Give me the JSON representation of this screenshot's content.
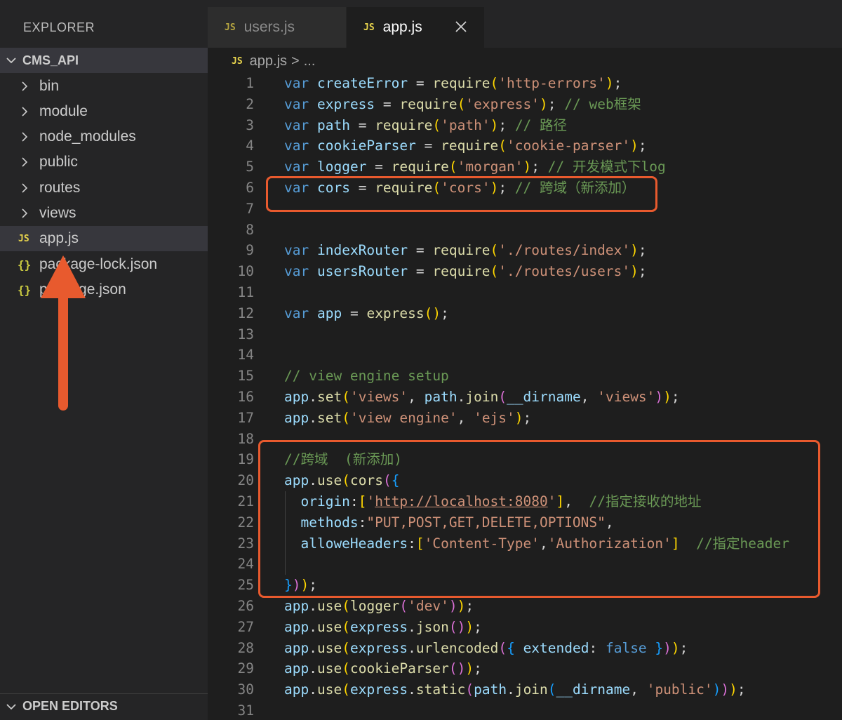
{
  "sidebar": {
    "title": "EXPLORER",
    "project": "CMS_API",
    "items": [
      {
        "label": "bin",
        "kind": "folder"
      },
      {
        "label": "module",
        "kind": "folder"
      },
      {
        "label": "node_modules",
        "kind": "folder"
      },
      {
        "label": "public",
        "kind": "folder"
      },
      {
        "label": "routes",
        "kind": "folder"
      },
      {
        "label": "views",
        "kind": "folder"
      },
      {
        "label": "app.js",
        "kind": "js",
        "badge": "JS",
        "selected": true
      },
      {
        "label": "package-lock.json",
        "kind": "json",
        "badge": "{}"
      },
      {
        "label": "package.json",
        "kind": "json",
        "badge": "{}"
      }
    ],
    "open_editors": "OPEN EDITORS"
  },
  "tabs": [
    {
      "label": "users.js",
      "badge": "JS",
      "active": false
    },
    {
      "label": "app.js",
      "badge": "JS",
      "active": true
    }
  ],
  "breadcrumb": {
    "badge": "JS",
    "file": "app.js",
    "separator": ">",
    "rest": "..."
  },
  "editor": {
    "lines": [
      {
        "n": "1",
        "tokens": [
          [
            "kw",
            "var"
          ],
          [
            "pu",
            " "
          ],
          [
            "vr",
            "createError"
          ],
          [
            "pu",
            " = "
          ],
          [
            "fn",
            "require"
          ],
          [
            "b1",
            "("
          ],
          [
            "st",
            "'http-errors'"
          ],
          [
            "b1",
            ")"
          ],
          [
            "pu",
            ";"
          ]
        ]
      },
      {
        "n": "2",
        "tokens": [
          [
            "kw",
            "var"
          ],
          [
            "pu",
            " "
          ],
          [
            "vr",
            "express"
          ],
          [
            "pu",
            " = "
          ],
          [
            "fn",
            "require"
          ],
          [
            "b1",
            "("
          ],
          [
            "st",
            "'express'"
          ],
          [
            "b1",
            ")"
          ],
          [
            "pu",
            "; "
          ],
          [
            "cm",
            "// web框架"
          ]
        ]
      },
      {
        "n": "3",
        "tokens": [
          [
            "kw",
            "var"
          ],
          [
            "pu",
            " "
          ],
          [
            "vr",
            "path"
          ],
          [
            "pu",
            " = "
          ],
          [
            "fn",
            "require"
          ],
          [
            "b1",
            "("
          ],
          [
            "st",
            "'path'"
          ],
          [
            "b1",
            ")"
          ],
          [
            "pu",
            "; "
          ],
          [
            "cm",
            "// 路径"
          ]
        ]
      },
      {
        "n": "4",
        "tokens": [
          [
            "kw",
            "var"
          ],
          [
            "pu",
            " "
          ],
          [
            "vr",
            "cookieParser"
          ],
          [
            "pu",
            " = "
          ],
          [
            "fn",
            "require"
          ],
          [
            "b1",
            "("
          ],
          [
            "st",
            "'cookie-parser'"
          ],
          [
            "b1",
            ")"
          ],
          [
            "pu",
            ";"
          ]
        ]
      },
      {
        "n": "5",
        "tokens": [
          [
            "kw",
            "var"
          ],
          [
            "pu",
            " "
          ],
          [
            "vr",
            "logger"
          ],
          [
            "pu",
            " = "
          ],
          [
            "fn",
            "require"
          ],
          [
            "b1",
            "("
          ],
          [
            "st",
            "'morgan'"
          ],
          [
            "b1",
            ")"
          ],
          [
            "pu",
            "; "
          ],
          [
            "cm",
            "// 开发模式下log"
          ]
        ]
      },
      {
        "n": "6",
        "tokens": [
          [
            "kw",
            "var"
          ],
          [
            "pu",
            " "
          ],
          [
            "vr",
            "cors"
          ],
          [
            "pu",
            " = "
          ],
          [
            "fn",
            "require"
          ],
          [
            "b1",
            "("
          ],
          [
            "st",
            "'cors'"
          ],
          [
            "b1",
            ")"
          ],
          [
            "pu",
            "; "
          ],
          [
            "cm",
            "// 跨域（新添加）"
          ]
        ]
      },
      {
        "n": "7",
        "tokens": []
      },
      {
        "n": "8",
        "tokens": []
      },
      {
        "n": "9",
        "tokens": [
          [
            "kw",
            "var"
          ],
          [
            "pu",
            " "
          ],
          [
            "vr",
            "indexRouter"
          ],
          [
            "pu",
            " = "
          ],
          [
            "fn",
            "require"
          ],
          [
            "b1",
            "("
          ],
          [
            "st",
            "'./routes/index'"
          ],
          [
            "b1",
            ")"
          ],
          [
            "pu",
            ";"
          ]
        ]
      },
      {
        "n": "10",
        "tokens": [
          [
            "kw",
            "var"
          ],
          [
            "pu",
            " "
          ],
          [
            "vr",
            "usersRouter"
          ],
          [
            "pu",
            " = "
          ],
          [
            "fn",
            "require"
          ],
          [
            "b1",
            "("
          ],
          [
            "st",
            "'./routes/users'"
          ],
          [
            "b1",
            ")"
          ],
          [
            "pu",
            ";"
          ]
        ]
      },
      {
        "n": "11",
        "tokens": []
      },
      {
        "n": "12",
        "tokens": [
          [
            "kw",
            "var"
          ],
          [
            "pu",
            " "
          ],
          [
            "vr",
            "app"
          ],
          [
            "pu",
            " = "
          ],
          [
            "fn",
            "express"
          ],
          [
            "b1",
            "()"
          ],
          [
            "pu",
            ";"
          ]
        ]
      },
      {
        "n": "13",
        "tokens": []
      },
      {
        "n": "14",
        "tokens": []
      },
      {
        "n": "15",
        "tokens": [
          [
            "cm",
            "// view engine setup"
          ]
        ]
      },
      {
        "n": "16",
        "tokens": [
          [
            "vr",
            "app"
          ],
          [
            "pu",
            "."
          ],
          [
            "fn",
            "set"
          ],
          [
            "b1",
            "("
          ],
          [
            "st",
            "'views'"
          ],
          [
            "pu",
            ", "
          ],
          [
            "vr",
            "path"
          ],
          [
            "pu",
            "."
          ],
          [
            "fn",
            "join"
          ],
          [
            "b2",
            "("
          ],
          [
            "vr",
            "__dirname"
          ],
          [
            "pu",
            ", "
          ],
          [
            "st",
            "'views'"
          ],
          [
            "b2",
            ")"
          ],
          [
            "b1",
            ")"
          ],
          [
            "pu",
            ";"
          ]
        ]
      },
      {
        "n": "17",
        "tokens": [
          [
            "vr",
            "app"
          ],
          [
            "pu",
            "."
          ],
          [
            "fn",
            "set"
          ],
          [
            "b1",
            "("
          ],
          [
            "st",
            "'view engine'"
          ],
          [
            "pu",
            ", "
          ],
          [
            "st",
            "'ejs'"
          ],
          [
            "b1",
            ")"
          ],
          [
            "pu",
            ";"
          ]
        ]
      },
      {
        "n": "18",
        "tokens": []
      },
      {
        "n": "19",
        "tokens": [
          [
            "cm",
            "//跨域  (新添加)"
          ]
        ]
      },
      {
        "n": "20",
        "tokens": [
          [
            "vr",
            "app"
          ],
          [
            "pu",
            "."
          ],
          [
            "fn",
            "use"
          ],
          [
            "b1",
            "("
          ],
          [
            "fn",
            "cors"
          ],
          [
            "b2",
            "("
          ],
          [
            "b3",
            "{"
          ]
        ]
      },
      {
        "n": "21",
        "guide": true,
        "tokens": [
          [
            "pu",
            "  "
          ],
          [
            "vr",
            "origin"
          ],
          [
            "pu",
            ":"
          ],
          [
            "b1",
            "["
          ],
          [
            "st",
            "'"
          ],
          [
            "st ul",
            "http://localhost:8080"
          ],
          [
            "st",
            "'"
          ],
          [
            "b1",
            "]"
          ],
          [
            "pu",
            ",  "
          ],
          [
            "cm",
            "//指定接收的地址"
          ]
        ]
      },
      {
        "n": "22",
        "guide": true,
        "tokens": [
          [
            "pu",
            "  "
          ],
          [
            "vr",
            "methods"
          ],
          [
            "pu",
            ":"
          ],
          [
            "st",
            "\"PUT,POST,GET,DELETE,OPTIONS\""
          ],
          [
            "pu",
            ","
          ]
        ]
      },
      {
        "n": "23",
        "guide": true,
        "tokens": [
          [
            "pu",
            "  "
          ],
          [
            "vr",
            "alloweHeaders"
          ],
          [
            "pu",
            ":"
          ],
          [
            "b1",
            "["
          ],
          [
            "st",
            "'Content-Type'"
          ],
          [
            "pu",
            ","
          ],
          [
            "st",
            "'Authorization'"
          ],
          [
            "b1",
            "]"
          ],
          [
            "pu",
            "  "
          ],
          [
            "cm",
            "//指定header"
          ]
        ]
      },
      {
        "n": "24",
        "guide": true,
        "tokens": []
      },
      {
        "n": "25",
        "tokens": [
          [
            "b3",
            "}"
          ],
          [
            "b2",
            ")"
          ],
          [
            "b1",
            ")"
          ],
          [
            "pu",
            ";"
          ]
        ]
      },
      {
        "n": "26",
        "tokens": [
          [
            "vr",
            "app"
          ],
          [
            "pu",
            "."
          ],
          [
            "fn",
            "use"
          ],
          [
            "b1",
            "("
          ],
          [
            "fn",
            "logger"
          ],
          [
            "b2",
            "("
          ],
          [
            "st",
            "'dev'"
          ],
          [
            "b2",
            ")"
          ],
          [
            "b1",
            ")"
          ],
          [
            "pu",
            ";"
          ]
        ]
      },
      {
        "n": "27",
        "tokens": [
          [
            "vr",
            "app"
          ],
          [
            "pu",
            "."
          ],
          [
            "fn",
            "use"
          ],
          [
            "b1",
            "("
          ],
          [
            "vr",
            "express"
          ],
          [
            "pu",
            "."
          ],
          [
            "fn",
            "json"
          ],
          [
            "b2",
            "()"
          ],
          [
            "b1",
            ")"
          ],
          [
            "pu",
            ";"
          ]
        ]
      },
      {
        "n": "28",
        "tokens": [
          [
            "vr",
            "app"
          ],
          [
            "pu",
            "."
          ],
          [
            "fn",
            "use"
          ],
          [
            "b1",
            "("
          ],
          [
            "vr",
            "express"
          ],
          [
            "pu",
            "."
          ],
          [
            "fn",
            "urlencoded"
          ],
          [
            "b2",
            "("
          ],
          [
            "b3",
            "{"
          ],
          [
            "pu",
            " "
          ],
          [
            "vr",
            "extended"
          ],
          [
            "pu",
            ": "
          ],
          [
            "kw",
            "false"
          ],
          [
            "pu",
            " "
          ],
          [
            "b3",
            "}"
          ],
          [
            "b2",
            ")"
          ],
          [
            "b1",
            ")"
          ],
          [
            "pu",
            ";"
          ]
        ]
      },
      {
        "n": "29",
        "tokens": [
          [
            "vr",
            "app"
          ],
          [
            "pu",
            "."
          ],
          [
            "fn",
            "use"
          ],
          [
            "b1",
            "("
          ],
          [
            "fn",
            "cookieParser"
          ],
          [
            "b2",
            "()"
          ],
          [
            "b1",
            ")"
          ],
          [
            "pu",
            ";"
          ]
        ]
      },
      {
        "n": "30",
        "tokens": [
          [
            "vr",
            "app"
          ],
          [
            "pu",
            "."
          ],
          [
            "fn",
            "use"
          ],
          [
            "b1",
            "("
          ],
          [
            "vr",
            "express"
          ],
          [
            "pu",
            "."
          ],
          [
            "fn",
            "static"
          ],
          [
            "b2",
            "("
          ],
          [
            "vr",
            "path"
          ],
          [
            "pu",
            "."
          ],
          [
            "fn",
            "join"
          ],
          [
            "b3",
            "("
          ],
          [
            "vr",
            "__dirname"
          ],
          [
            "pu",
            ", "
          ],
          [
            "st",
            "'public'"
          ],
          [
            "b3",
            ")"
          ],
          [
            "b2",
            ")"
          ],
          [
            "b1",
            ")"
          ],
          [
            "pu",
            ";"
          ]
        ]
      },
      {
        "n": "31",
        "tokens": []
      }
    ]
  },
  "colors": {
    "annotation": "#e85a2e",
    "keyword": "#569cd6",
    "string": "#ce9178",
    "comment": "#6a9955"
  }
}
